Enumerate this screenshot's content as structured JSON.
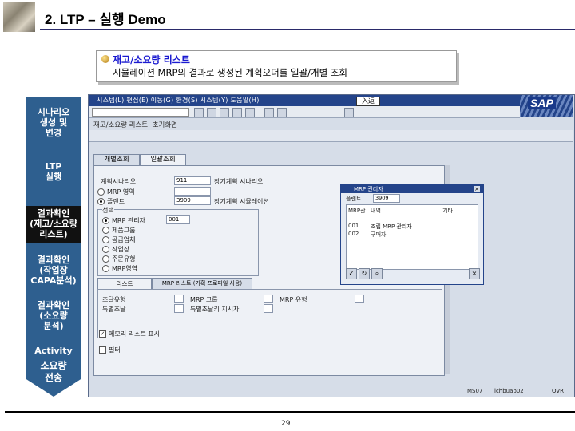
{
  "slide": {
    "title": "2. LTP – 실행 Demo",
    "page_number": "29"
  },
  "callout": {
    "title": "재고/소요량 리스트",
    "subtitle": "시뮬레이션 MRP의 결과로 생성된 계획오더를 일괄/개별 조회"
  },
  "steps": [
    {
      "label": "시나리오\n생성 및\n변경",
      "highlighted": false
    },
    {
      "label": "LTP\n실행",
      "highlighted": false
    },
    {
      "label": "결과확인\n(재고/소요량\n리스트)",
      "highlighted": true
    },
    {
      "label": "결과확인\n(작업장\nCAPA분석)",
      "highlighted": false
    },
    {
      "label": "결과확인\n(소요량\n분석)",
      "highlighted": false
    },
    {
      "label": "Activity",
      "highlighted": false
    },
    {
      "label": "소요량\n전송",
      "highlighted": false
    }
  ],
  "sap": {
    "menubar": "시스템(L)  편집(E)  이동(G)  환경(S)  시스템(Y)  도움말(H)",
    "command_box": "入返",
    "logo": "SAP",
    "screen_title": "재고/소요량 리스트: 초기화면",
    "tabs": [
      {
        "label": "개별조회",
        "active": false
      },
      {
        "label": "일괄조회",
        "active": true
      }
    ],
    "form": {
      "row1_label": "계획시나리오",
      "row1_value": "911",
      "row1_right": "장기계획 시나리오",
      "radio_mrp_area": "MRP 영역",
      "radio_plant": "플랜트",
      "plant_value": "3909",
      "plant_right": "장기계획 시뮬레이션",
      "selection_group": "선택",
      "radio_controller": "MRP 관리자",
      "controller_value": "001",
      "radio_product_group": "제품그룹",
      "radio_vendor": "공급업체",
      "radio_work_center": "작업장",
      "radio_planning_group": "주문유형",
      "radio_mrp_area2": "MRP영역",
      "subtab1": "리스트",
      "subtab2": "MRP 리스트 (기획 프로파일 사용)",
      "bottom_left1": "조달유형",
      "bottom_left2": "특별조달",
      "bottom_mid1": "MRP 그룹",
      "bottom_mid2": "특별조달키 지시자",
      "bottom_right": "MRP 유형",
      "check_label": "메모리 리스트 표시",
      "check2_label": "필터"
    },
    "popup": {
      "title": "MRP 관리자",
      "field_label": "플랜트",
      "field_value": "3909",
      "col1": "MRP관",
      "col2": "내역",
      "col3": "기타",
      "row1_code": "001",
      "row1_text": "조립 MRP 관리자",
      "row2_code": "002",
      "row2_text": "구매자"
    },
    "status": {
      "sid": "MS07",
      "host": "lchbuap02",
      "mode": "OVR"
    }
  }
}
